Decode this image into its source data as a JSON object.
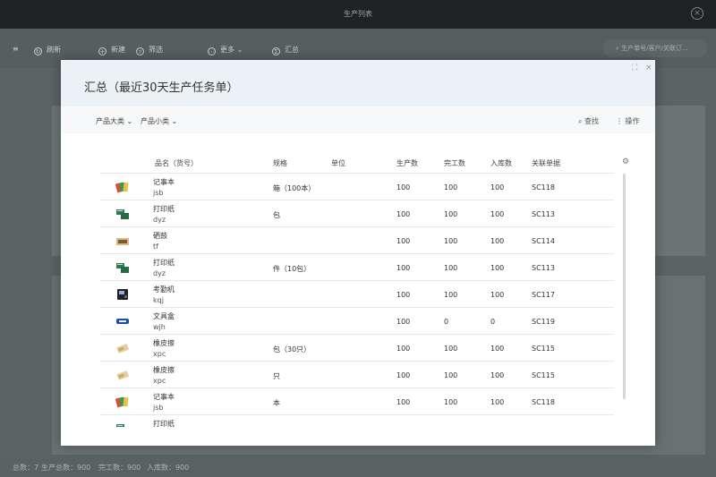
{
  "app": {
    "title": "生产列表",
    "toolbar": {
      "refresh": "刷新",
      "new": "新建",
      "filter": "筛选",
      "more": "更多",
      "summary": "汇总",
      "search_placeholder": "生产单号/客户/关联订..."
    },
    "status": {
      "total": "总数：7",
      "produced": "生产总数：900",
      "completed": "完工数：900",
      "stocked": "入库数：900"
    }
  },
  "modal": {
    "title": "汇总（最近30天生产任务单）",
    "filters": {
      "category": "产品大类",
      "subcategory": "产品小类"
    },
    "actions": {
      "search": "查找",
      "operate": "操作"
    },
    "columns": [
      "品名（货号）",
      "规格",
      "单位",
      "生产数",
      "完工数",
      "入库数",
      "关联单据"
    ],
    "rows": [
      {
        "name": "记事本",
        "code": "jsb",
        "spec": "箱（100本）",
        "unit": "",
        "produced": "100",
        "completed": "100",
        "stocked": "100",
        "doc": "SC118",
        "icon": "notebook-icon"
      },
      {
        "name": "打印纸",
        "code": "dyz",
        "spec": "包",
        "unit": "",
        "produced": "100",
        "completed": "100",
        "stocked": "100",
        "doc": "SC113",
        "icon": "printer-paper-icon"
      },
      {
        "name": "硒鼓",
        "code": "tf",
        "spec": "",
        "unit": "",
        "produced": "100",
        "completed": "100",
        "stocked": "100",
        "doc": "SC114",
        "icon": "toner-cartridge-icon"
      },
      {
        "name": "打印纸",
        "code": "dyz",
        "spec": "件（10包）",
        "unit": "",
        "produced": "100",
        "completed": "100",
        "stocked": "100",
        "doc": "SC113",
        "icon": "printer-paper-icon"
      },
      {
        "name": "考勤机",
        "code": "kqj",
        "spec": "",
        "unit": "",
        "produced": "100",
        "completed": "100",
        "stocked": "100",
        "doc": "SC117",
        "icon": "attendance-machine-icon"
      },
      {
        "name": "文具盒",
        "code": "wjh",
        "spec": "",
        "unit": "",
        "produced": "100",
        "completed": "0",
        "stocked": "0",
        "doc": "SC119",
        "icon": "pencil-case-icon"
      },
      {
        "name": "橡皮擦",
        "code": "xpc",
        "spec": "包（30只）",
        "unit": "",
        "produced": "100",
        "completed": "100",
        "stocked": "100",
        "doc": "SC115",
        "icon": "eraser-icon"
      },
      {
        "name": "橡皮擦",
        "code": "xpc",
        "spec": "只",
        "unit": "",
        "produced": "100",
        "completed": "100",
        "stocked": "100",
        "doc": "SC115",
        "icon": "eraser-icon"
      },
      {
        "name": "记事本",
        "code": "jsb",
        "spec": "本",
        "unit": "",
        "produced": "100",
        "completed": "100",
        "stocked": "100",
        "doc": "SC118",
        "icon": "notebook-icon"
      },
      {
        "name": "打印纸",
        "code": "",
        "spec": "",
        "unit": "",
        "produced": "",
        "completed": "",
        "stocked": "",
        "doc": "",
        "icon": "printer-paper-icon"
      }
    ]
  },
  "colors": {
    "header_bg": "#ecf1f5",
    "titlebar_bg": "#1f2222",
    "overlay": "#5f6b6b"
  }
}
